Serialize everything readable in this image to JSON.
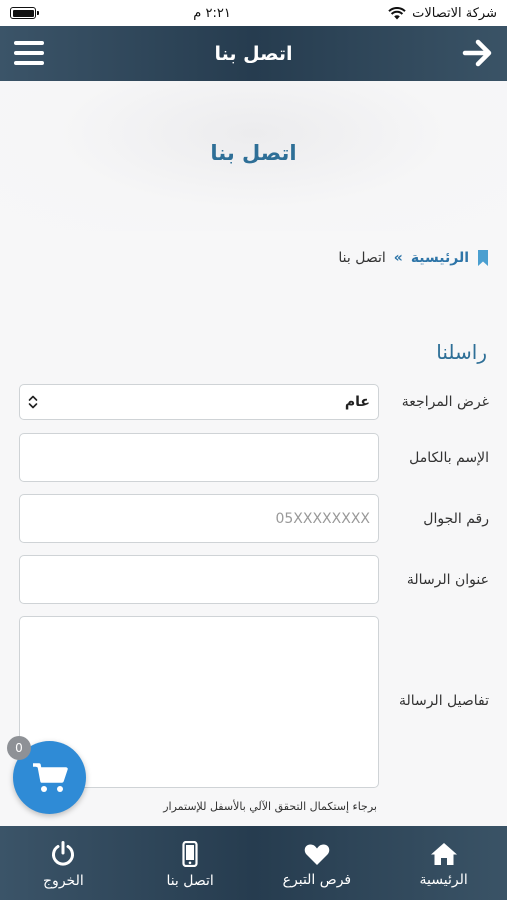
{
  "status_bar": {
    "time": "٢:٢١ م",
    "carrier": "شركة الاتصالات"
  },
  "header": {
    "title": "اتصل بنا"
  },
  "hero": {
    "title": "اتصل بنا"
  },
  "breadcrumb": {
    "home": "الرئيسية",
    "separator": "»",
    "current": "اتصل بنا"
  },
  "form": {
    "section_title": "راسلنا",
    "purpose_label": "غرض المراجعة",
    "purpose_value": "عام",
    "name_label": "الإسم بالكامل",
    "name_value": "",
    "mobile_label": "رقم الجوال",
    "mobile_placeholder": "05XXXXXXXX",
    "subject_label": "عنوان الرسالة",
    "subject_value": "",
    "details_label": "تفاصيل الرسالة",
    "details_value": "",
    "captcha_note": "برجاء إستكمال التحقق الآلي بالأسفل للإستمرار"
  },
  "cart": {
    "count": "0"
  },
  "bottom_nav": [
    {
      "label": "الرئيسية",
      "icon": "home-icon"
    },
    {
      "label": "فرص التبرع",
      "icon": "heart-icon"
    },
    {
      "label": "اتصل بنا",
      "icon": "mobile-phone-icon"
    },
    {
      "label": "الخروج",
      "icon": "power-icon"
    }
  ],
  "colors": {
    "header_bg": "#2b4356",
    "accent": "#2e6f97",
    "cart": "#2f8bd6"
  }
}
